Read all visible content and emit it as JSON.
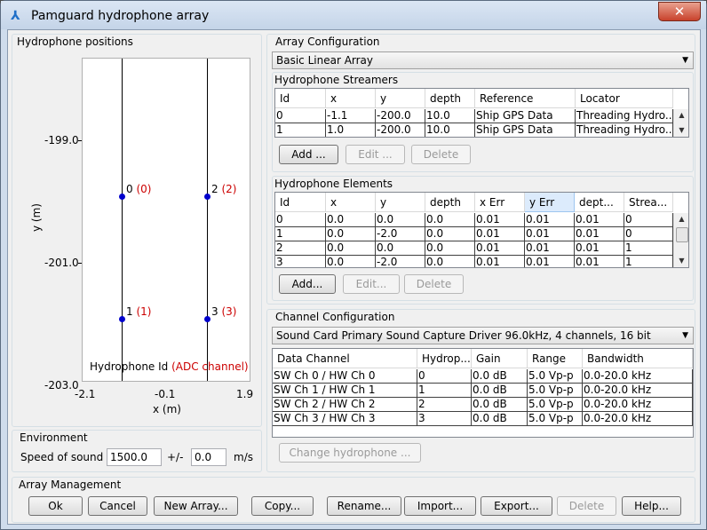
{
  "window": {
    "title": "Pamguard hydrophone array",
    "close_label": "✕"
  },
  "positions": {
    "group_label": "Hydrophone positions",
    "y_axis_label": "y (m)",
    "x_axis_label": "x (m)",
    "y_ticks": [
      "-199.0",
      "-201.0",
      "-203.0"
    ],
    "x_ticks": [
      "-2.1",
      "-0.1",
      "1.9"
    ],
    "legend_id": "Hydrophone Id",
    "legend_channel": "(ADC channel)",
    "hydrophones": [
      {
        "id": "0",
        "channel": "(0)"
      },
      {
        "id": "1",
        "channel": "(1)"
      },
      {
        "id": "2",
        "channel": "(2)"
      },
      {
        "id": "3",
        "channel": "(3)"
      }
    ],
    "colors": {
      "marker": "#0000cc",
      "channel_text": "#cc0000"
    }
  },
  "environment": {
    "group_label": "Environment",
    "speed_label": "Speed of sound",
    "speed_value": "1500.0",
    "pm_label": "+/-",
    "pm_value": "0.0",
    "unit": "m/s"
  },
  "array_config": {
    "group_label": "Array Configuration",
    "type_value": "Basic Linear Array",
    "streamers": {
      "label": "Hydrophone Streamers",
      "columns": [
        "Id",
        "x",
        "y",
        "depth",
        "Reference",
        "Locator"
      ],
      "rows": [
        [
          "0",
          "-1.1",
          "-200.0",
          "10.0",
          "Ship GPS Data",
          "Threading Hydro..."
        ],
        [
          "1",
          "1.0",
          "-200.0",
          "10.0",
          "Ship GPS Data",
          "Threading Hydro..."
        ]
      ],
      "add_label": "Add ...",
      "edit_label": "Edit ...",
      "delete_label": "Delete"
    },
    "elements": {
      "label": "Hydrophone Elements",
      "columns": [
        "Id",
        "x",
        "y",
        "depth",
        "x Err",
        "y Err",
        "dept...",
        "Strea..."
      ],
      "rows": [
        [
          "0",
          "0.0",
          "0.0",
          "0.0",
          "0.01",
          "0.01",
          "0.01",
          "0"
        ],
        [
          "1",
          "0.0",
          "-2.0",
          "0.0",
          "0.01",
          "0.01",
          "0.01",
          "0"
        ],
        [
          "2",
          "0.0",
          "0.0",
          "0.0",
          "0.01",
          "0.01",
          "0.01",
          "1"
        ],
        [
          "3",
          "0.0",
          "-2.0",
          "0.0",
          "0.01",
          "0.01",
          "0.01",
          "1"
        ]
      ],
      "add_label": "Add...",
      "edit_label": "Edit...",
      "delete_label": "Delete"
    }
  },
  "channel_config": {
    "group_label": "Channel Configuration",
    "source_value": "Sound Card Primary Sound Capture Driver 96.0kHz, 4 channels, 16 bit",
    "columns": [
      "Data Channel",
      "Hydrop...",
      "Gain",
      "Range",
      "Bandwidth"
    ],
    "rows": [
      [
        "SW Ch 0 / HW Ch 0",
        "0",
        "0.0 dB",
        "5.0 Vp-p",
        "0.0-20.0 kHz"
      ],
      [
        "SW Ch 1 / HW Ch 1",
        "1",
        "0.0 dB",
        "5.0 Vp-p",
        "0.0-20.0 kHz"
      ],
      [
        "SW Ch 2 / HW Ch 2",
        "2",
        "0.0 dB",
        "5.0 Vp-p",
        "0.0-20.0 kHz"
      ],
      [
        "SW Ch 3 / HW Ch 3",
        "3",
        "0.0 dB",
        "5.0 Vp-p",
        "0.0-20.0 kHz"
      ]
    ],
    "change_label": "Change hydrophone ..."
  },
  "management": {
    "group_label": "Array Management",
    "buttons": [
      "Ok",
      "Cancel",
      "New Array...",
      "Copy...",
      "Rename...",
      "Import...",
      "Export...",
      "Delete",
      "Help..."
    ]
  }
}
